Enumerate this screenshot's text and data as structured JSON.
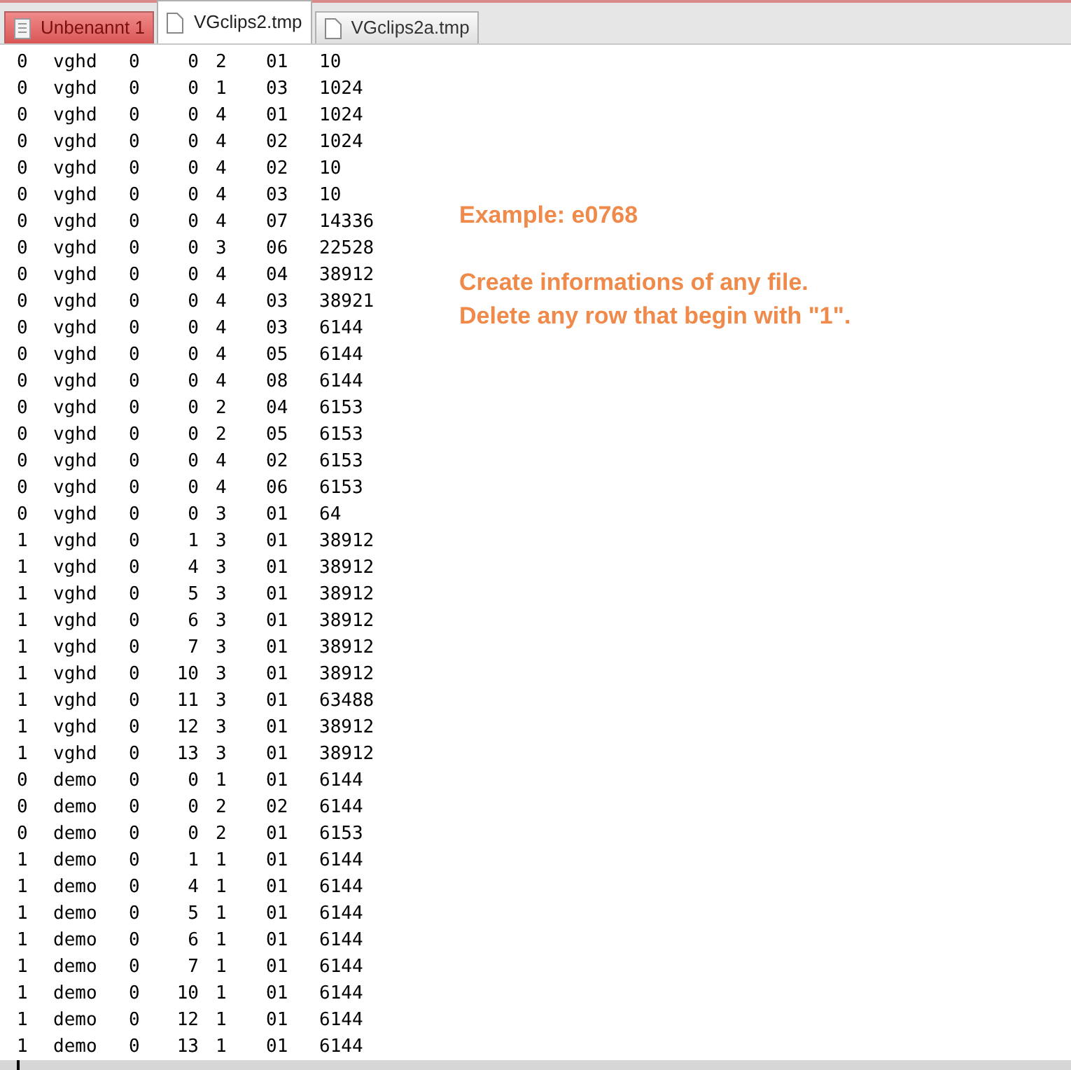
{
  "tabs": [
    {
      "label": "Unbenannt 1",
      "kind": "unsaved",
      "selected": false
    },
    {
      "label": "VGclips2.tmp",
      "kind": "file",
      "selected": true
    },
    {
      "label": "VGclips2a.tmp",
      "kind": "file",
      "selected": false
    }
  ],
  "rows": [
    [
      "0",
      "vghd",
      "0",
      "0",
      "2",
      "01",
      "10"
    ],
    [
      "0",
      "vghd",
      "0",
      "0",
      "1",
      "03",
      "1024"
    ],
    [
      "0",
      "vghd",
      "0",
      "0",
      "4",
      "01",
      "1024"
    ],
    [
      "0",
      "vghd",
      "0",
      "0",
      "4",
      "02",
      "1024"
    ],
    [
      "0",
      "vghd",
      "0",
      "0",
      "4",
      "02",
      "10"
    ],
    [
      "0",
      "vghd",
      "0",
      "0",
      "4",
      "03",
      "10"
    ],
    [
      "0",
      "vghd",
      "0",
      "0",
      "4",
      "07",
      "14336"
    ],
    [
      "0",
      "vghd",
      "0",
      "0",
      "3",
      "06",
      "22528"
    ],
    [
      "0",
      "vghd",
      "0",
      "0",
      "4",
      "04",
      "38912"
    ],
    [
      "0",
      "vghd",
      "0",
      "0",
      "4",
      "03",
      "38921"
    ],
    [
      "0",
      "vghd",
      "0",
      "0",
      "4",
      "03",
      "6144"
    ],
    [
      "0",
      "vghd",
      "0",
      "0",
      "4",
      "05",
      "6144"
    ],
    [
      "0",
      "vghd",
      "0",
      "0",
      "4",
      "08",
      "6144"
    ],
    [
      "0",
      "vghd",
      "0",
      "0",
      "2",
      "04",
      "6153"
    ],
    [
      "0",
      "vghd",
      "0",
      "0",
      "2",
      "05",
      "6153"
    ],
    [
      "0",
      "vghd",
      "0",
      "0",
      "4",
      "02",
      "6153"
    ],
    [
      "0",
      "vghd",
      "0",
      "0",
      "4",
      "06",
      "6153"
    ],
    [
      "0",
      "vghd",
      "0",
      "0",
      "3",
      "01",
      "64"
    ],
    [
      "1",
      "vghd",
      "0",
      "1",
      "3",
      "01",
      "38912"
    ],
    [
      "1",
      "vghd",
      "0",
      "4",
      "3",
      "01",
      "38912"
    ],
    [
      "1",
      "vghd",
      "0",
      "5",
      "3",
      "01",
      "38912"
    ],
    [
      "1",
      "vghd",
      "0",
      "6",
      "3",
      "01",
      "38912"
    ],
    [
      "1",
      "vghd",
      "0",
      "7",
      "3",
      "01",
      "38912"
    ],
    [
      "1",
      "vghd",
      "0",
      "10",
      "3",
      "01",
      "38912"
    ],
    [
      "1",
      "vghd",
      "0",
      "11",
      "3",
      "01",
      "63488"
    ],
    [
      "1",
      "vghd",
      "0",
      "12",
      "3",
      "01",
      "38912"
    ],
    [
      "1",
      "vghd",
      "0",
      "13",
      "3",
      "01",
      "38912"
    ],
    [
      "0",
      "demo",
      "0",
      "0",
      "1",
      "01",
      "6144"
    ],
    [
      "0",
      "demo",
      "0",
      "0",
      "2",
      "02",
      "6144"
    ],
    [
      "0",
      "demo",
      "0",
      "0",
      "2",
      "01",
      "6153"
    ],
    [
      "1",
      "demo",
      "0",
      "1",
      "1",
      "01",
      "6144"
    ],
    [
      "1",
      "demo",
      "0",
      "4",
      "1",
      "01",
      "6144"
    ],
    [
      "1",
      "demo",
      "0",
      "5",
      "1",
      "01",
      "6144"
    ],
    [
      "1",
      "demo",
      "0",
      "6",
      "1",
      "01",
      "6144"
    ],
    [
      "1",
      "demo",
      "0",
      "7",
      "1",
      "01",
      "6144"
    ],
    [
      "1",
      "demo",
      "0",
      "10",
      "1",
      "01",
      "6144"
    ],
    [
      "1",
      "demo",
      "0",
      "12",
      "1",
      "01",
      "6144"
    ],
    [
      "1",
      "demo",
      "0",
      "13",
      "1",
      "01",
      "6144"
    ]
  ],
  "note": {
    "title": "Example: e0768",
    "lines": [
      "Create informations of any file.",
      "Delete any row that begin with \"1\"."
    ]
  }
}
